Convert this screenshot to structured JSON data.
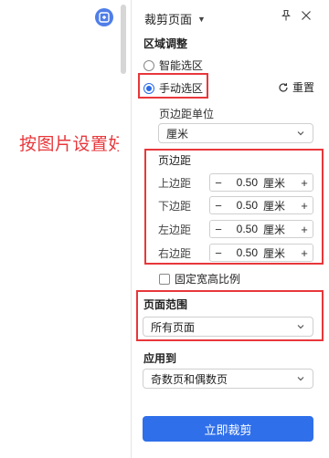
{
  "annotation": "按图片设置好",
  "panel": {
    "title": "裁剪页面",
    "region_section": "区域调整",
    "smart_select": "智能选区",
    "manual_select": "手动选区",
    "reset": "重置",
    "margin_unit_label": "页边距单位",
    "unit_value": "厘米",
    "margin_section": "页边距",
    "margins": [
      {
        "label": "上边距",
        "value": "0.50",
        "unit": "厘米"
      },
      {
        "label": "下边距",
        "value": "0.50",
        "unit": "厘米"
      },
      {
        "label": "左边距",
        "value": "0.50",
        "unit": "厘米"
      },
      {
        "label": "右边距",
        "value": "0.50",
        "unit": "厘米"
      }
    ],
    "fixed_ratio": "固定宽高比例",
    "page_range_section": "页面范围",
    "page_range_value": "所有页面",
    "apply_to_section": "应用到",
    "apply_to_value": "奇数页和偶数页",
    "crop_now": "立即裁剪"
  },
  "colors": {
    "accent": "#2f6fea",
    "annotation_red": "#e8373b"
  }
}
